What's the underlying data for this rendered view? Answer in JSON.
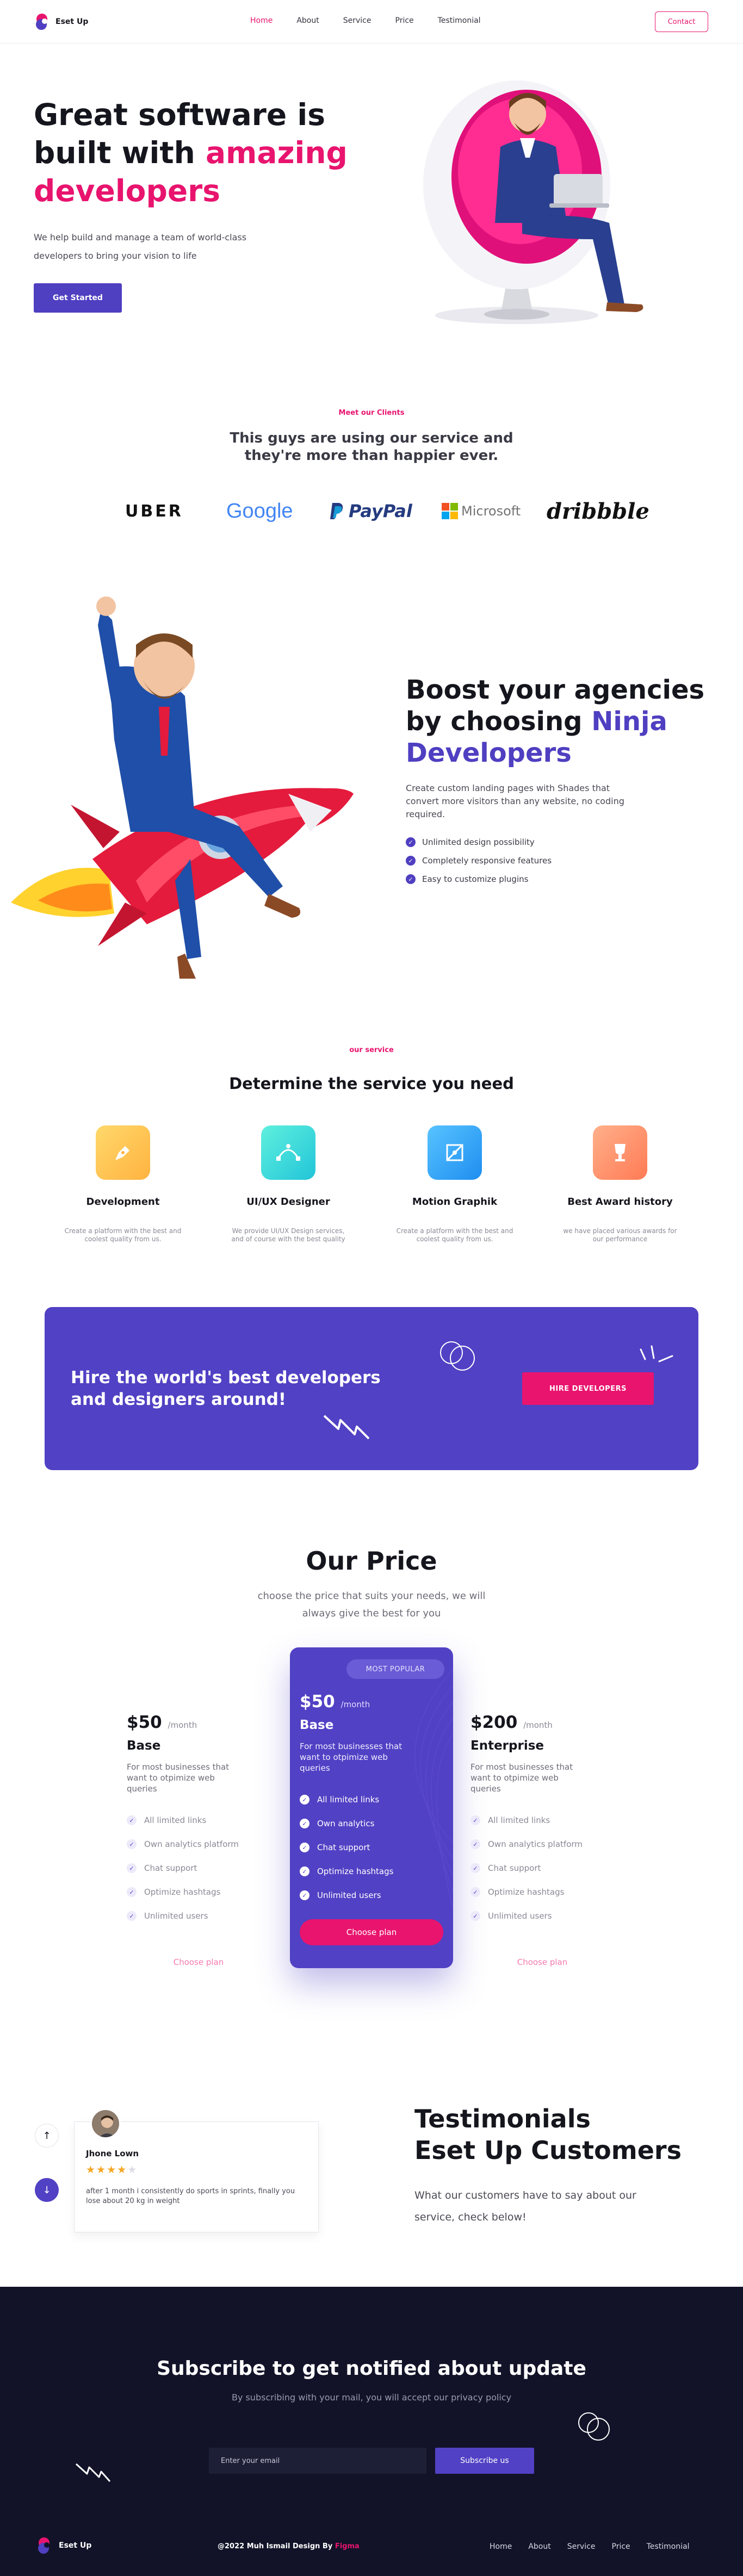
{
  "brand": {
    "name": "Eset Up"
  },
  "nav": {
    "links": [
      "Home",
      "About",
      "Service",
      "Price",
      "Testimonial"
    ],
    "contact_label": "Contact"
  },
  "hero": {
    "title_line1": "Great software is",
    "title_line2_plain": "built with ",
    "title_line2_accent": "amazing",
    "title_line3_accent": "developers",
    "subtitle": "We help build and manage a team of world-class developers to bring your vision to life",
    "cta_label": "Get Started"
  },
  "clients": {
    "eyebrow": "Meet our Clients",
    "title": "This guys are using our service and they're more than happier ever.",
    "logos": [
      "UBER",
      "Google",
      "PayPal",
      "Microsoft",
      "dribbble"
    ]
  },
  "boost": {
    "title_line1": "Boost your agencies",
    "title_line2_plain": "by choosing ",
    "title_line2_accent": "Ninja",
    "title_line3_accent": "Developers",
    "description": "Create custom landing pages with Shades that convert more visitors than any website, no coding required.",
    "features": [
      "Unlimited design possibility",
      "Completely responsive features",
      "Easy to customize plugins"
    ]
  },
  "service": {
    "eyebrow": "our service",
    "title": "Determine the service you need",
    "cards": [
      {
        "name": "Development",
        "desc": "Create a platform with the best and coolest quality from us.",
        "icon": "pen-tool-icon"
      },
      {
        "name": "UI/UX Designer",
        "desc": "We provide UI/UX Design services, and of course with the best quality",
        "icon": "bezier-curve-icon"
      },
      {
        "name": "Motion Graphik",
        "desc": "Create a platform with the best and coolest quality from us.",
        "icon": "vector-frame-icon"
      },
      {
        "name": "Best Award history",
        "desc": "we have placed various awards for our performance",
        "icon": "trophy-icon"
      }
    ]
  },
  "hire": {
    "title": "Hire the world's best developers and designers around!",
    "cta_label": "HIRE DEVELOPERS"
  },
  "price": {
    "title": "Our Price",
    "subtitle": "choose the price that suits your needs, we will always give the best for you",
    "plans": [
      {
        "price": "$50",
        "per": "/month",
        "name": "Base",
        "desc": "For most businesses that want to otpimize web queries",
        "features": [
          "All limited links",
          "Own analytics platform",
          "Chat support",
          "Optimize hashtags",
          "Unlimited users"
        ],
        "cta": "Choose plan"
      },
      {
        "badge": "MOST POPULAR",
        "price": "$50",
        "per": "/month",
        "name": "Base",
        "desc": "For most businesses that want to otpimize web queries",
        "features": [
          "All limited links",
          "Own analytics",
          "Chat support",
          "Optimize hashtags",
          "Unlimited users"
        ],
        "cta": "Choose plan"
      },
      {
        "price": "$200",
        "per": "/month",
        "name": "Enterprise",
        "desc": "For most businesses that want to otpimize web queries",
        "features": [
          "All limited links",
          "Own analytics platform",
          "Chat support",
          "Optimize hashtags",
          "Unlimited users"
        ],
        "cta": "Choose plan"
      }
    ]
  },
  "testimonials": {
    "title_line1": "Testimonials",
    "title_line2": "Eset Up Customers",
    "subtitle": "What our customers have to say about our service, check below!",
    "card": {
      "name": "Jhone Lown",
      "rating": 4,
      "max_rating": 5,
      "quote": "after 1 month i consistently do sports in sprints, finally you lose about 20 kg in weight"
    }
  },
  "subscribe": {
    "title": "Subscribe to get notified about update",
    "subtitle": "By subscribing with your mail, you will accept our privacy policy",
    "input_placeholder": "Enter your email",
    "cta_label": "Subscribe us"
  },
  "footer": {
    "copyright_prefix": "@2022 Muh Ismail Design By ",
    "copyright_accent": "Figma",
    "links": [
      "Home",
      "About",
      "Service",
      "Price",
      "Testimonial"
    ]
  },
  "colors": {
    "accent_pink": "#e8146e",
    "primary_purple": "#4f3fc1",
    "footer_bg": "#121328"
  }
}
